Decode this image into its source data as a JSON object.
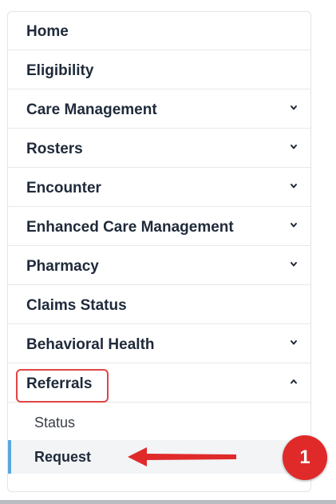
{
  "nav": {
    "items": [
      {
        "label": "Home",
        "expandable": false
      },
      {
        "label": "Eligibility",
        "expandable": false
      },
      {
        "label": "Care Management",
        "expandable": true,
        "chevron": "chevron-down-icon"
      },
      {
        "label": "Rosters",
        "expandable": true,
        "chevron": "chevron-down-icon"
      },
      {
        "label": "Encounter",
        "expandable": true,
        "chevron": "chevron-down-icon"
      },
      {
        "label": "Enhanced Care Management",
        "expandable": true,
        "chevron": "chevron-down-icon"
      },
      {
        "label": "Pharmacy",
        "expandable": true,
        "chevron": "chevron-down-icon"
      },
      {
        "label": "Claims Status",
        "expandable": false
      },
      {
        "label": "Behavioral Health",
        "expandable": true,
        "chevron": "chevron-down-icon"
      },
      {
        "label": "Referrals",
        "expandable": true,
        "expanded": true,
        "chevron": "chevron-up-icon"
      }
    ],
    "referrals_submenu": [
      {
        "label": "Status",
        "active": false
      },
      {
        "label": "Request",
        "active": true
      }
    ]
  },
  "annotation": {
    "step_badge": "1",
    "highlight_color": "#e04545",
    "badge_color": "#e02a2a",
    "arrow_color": "#e02a2a"
  },
  "colors": {
    "text": "#1f2a3a",
    "active_indicator": "#5aa7e0",
    "active_background": "#f2f4f6"
  }
}
